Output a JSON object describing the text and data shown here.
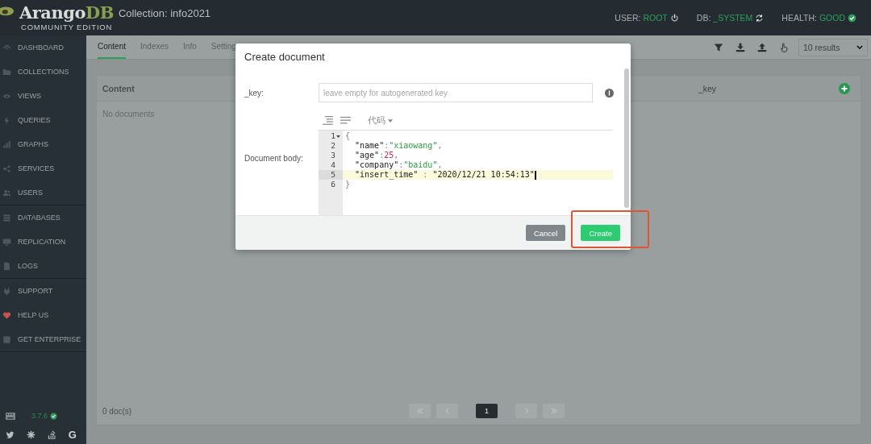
{
  "header": {
    "logo": {
      "wordmark": "Arango",
      "wordmark_accent": "DB",
      "edition": "COMMUNITY EDITION"
    },
    "title": "Collection: info2021",
    "status": [
      {
        "label": "USER:",
        "value": "ROOT",
        "kind": "power"
      },
      {
        "label": "DB:",
        "value": "_SYSTEM",
        "kind": "refresh"
      },
      {
        "label": "HEALTH:",
        "value": "GOOD",
        "kind": "check"
      }
    ]
  },
  "sidebar": {
    "sections": [
      {
        "items": [
          {
            "label": "DASHBOARD",
            "kind": "dashboard"
          },
          {
            "label": "COLLECTIONS",
            "kind": "collections"
          },
          {
            "label": "VIEWS",
            "kind": "views"
          },
          {
            "label": "QUERIES",
            "kind": "queries"
          },
          {
            "label": "GRAPHS",
            "kind": "graphs"
          },
          {
            "label": "SERVICES",
            "kind": "services"
          },
          {
            "label": "USERS",
            "kind": "users"
          }
        ]
      },
      {
        "items": [
          {
            "label": "DATABASES",
            "kind": "databases"
          },
          {
            "label": "REPLICATION",
            "kind": "replication"
          },
          {
            "label": "LOGS",
            "kind": "logs"
          }
        ]
      },
      {
        "items": [
          {
            "label": "SUPPORT",
            "kind": "support"
          },
          {
            "label": "HELP US",
            "kind": "help"
          },
          {
            "label": "GET ENTERPRISE",
            "kind": "enterprise"
          }
        ]
      }
    ],
    "version": "3.7.6",
    "links": [
      {
        "kind": "twitter"
      },
      {
        "kind": "slack"
      },
      {
        "kind": "stackoverflow"
      },
      {
        "kind": "google",
        "text": "G"
      }
    ]
  },
  "tabs": [
    {
      "label": "Content",
      "selected": true
    },
    {
      "label": "Indexes",
      "selected": false
    },
    {
      "label": "Info",
      "selected": false
    },
    {
      "label": "Setting",
      "selected": false
    }
  ],
  "toolbar": {
    "tools": [
      {
        "kind": "filter"
      },
      {
        "kind": "download"
      },
      {
        "kind": "upload"
      },
      {
        "kind": "hand"
      }
    ],
    "results": "10 results"
  },
  "content": {
    "title": "Content",
    "column": "_key",
    "empty": "No documents",
    "count": "0 doc(s)",
    "pagination": [
      {
        "kind": "first"
      },
      {
        "kind": "prev"
      },
      {
        "kind": "page",
        "label": "1",
        "selected": true
      },
      {
        "kind": "next"
      },
      {
        "kind": "last"
      }
    ]
  },
  "modal": {
    "title": "Create document",
    "key_label": "_key:",
    "key_placeholder": "leave empty for autogenerated key",
    "body_label": "Document body:",
    "editor": {
      "mode": "代码",
      "lines": [
        {
          "number": "1",
          "foldable": true,
          "active": false,
          "cursor": false,
          "tokens": [
            {
              "text": "{",
              "kind": "punct"
            }
          ]
        },
        {
          "number": "2",
          "foldable": false,
          "active": false,
          "cursor": false,
          "tokens": [
            {
              "text": "  \"name\"",
              "kind": "key"
            },
            {
              "text": ":",
              "kind": "punct"
            },
            {
              "text": "\"xiaowang\"",
              "kind": "string"
            },
            {
              "text": ",",
              "kind": "punct"
            }
          ]
        },
        {
          "number": "3",
          "foldable": false,
          "active": false,
          "cursor": false,
          "tokens": [
            {
              "text": "  \"age\"",
              "kind": "key"
            },
            {
              "text": ":",
              "kind": "punct"
            },
            {
              "text": "25",
              "kind": "number"
            },
            {
              "text": ",",
              "kind": "punct"
            }
          ]
        },
        {
          "number": "4",
          "foldable": false,
          "active": false,
          "cursor": false,
          "tokens": [
            {
              "text": "  \"company\"",
              "kind": "key"
            },
            {
              "text": ":",
              "kind": "punct"
            },
            {
              "text": "\"baidu\"",
              "kind": "string"
            },
            {
              "text": ",",
              "kind": "punct"
            }
          ]
        },
        {
          "number": "5",
          "foldable": false,
          "active": true,
          "cursor": true,
          "tokens": [
            {
              "text": "  \"insert_time\"",
              "kind": "key"
            },
            {
              "text": " : ",
              "kind": "punct"
            },
            {
              "text": "\"2020/12/21 10:54:13\"",
              "kind": "plain"
            }
          ]
        },
        {
          "number": "6",
          "foldable": false,
          "active": false,
          "cursor": false,
          "tokens": [
            {
              "text": "}",
              "kind": "punct"
            }
          ]
        }
      ]
    },
    "buttons": [
      {
        "label": "Cancel",
        "kind": "secondary"
      },
      {
        "label": "Create",
        "kind": "primary",
        "highlighted": true
      }
    ]
  }
}
